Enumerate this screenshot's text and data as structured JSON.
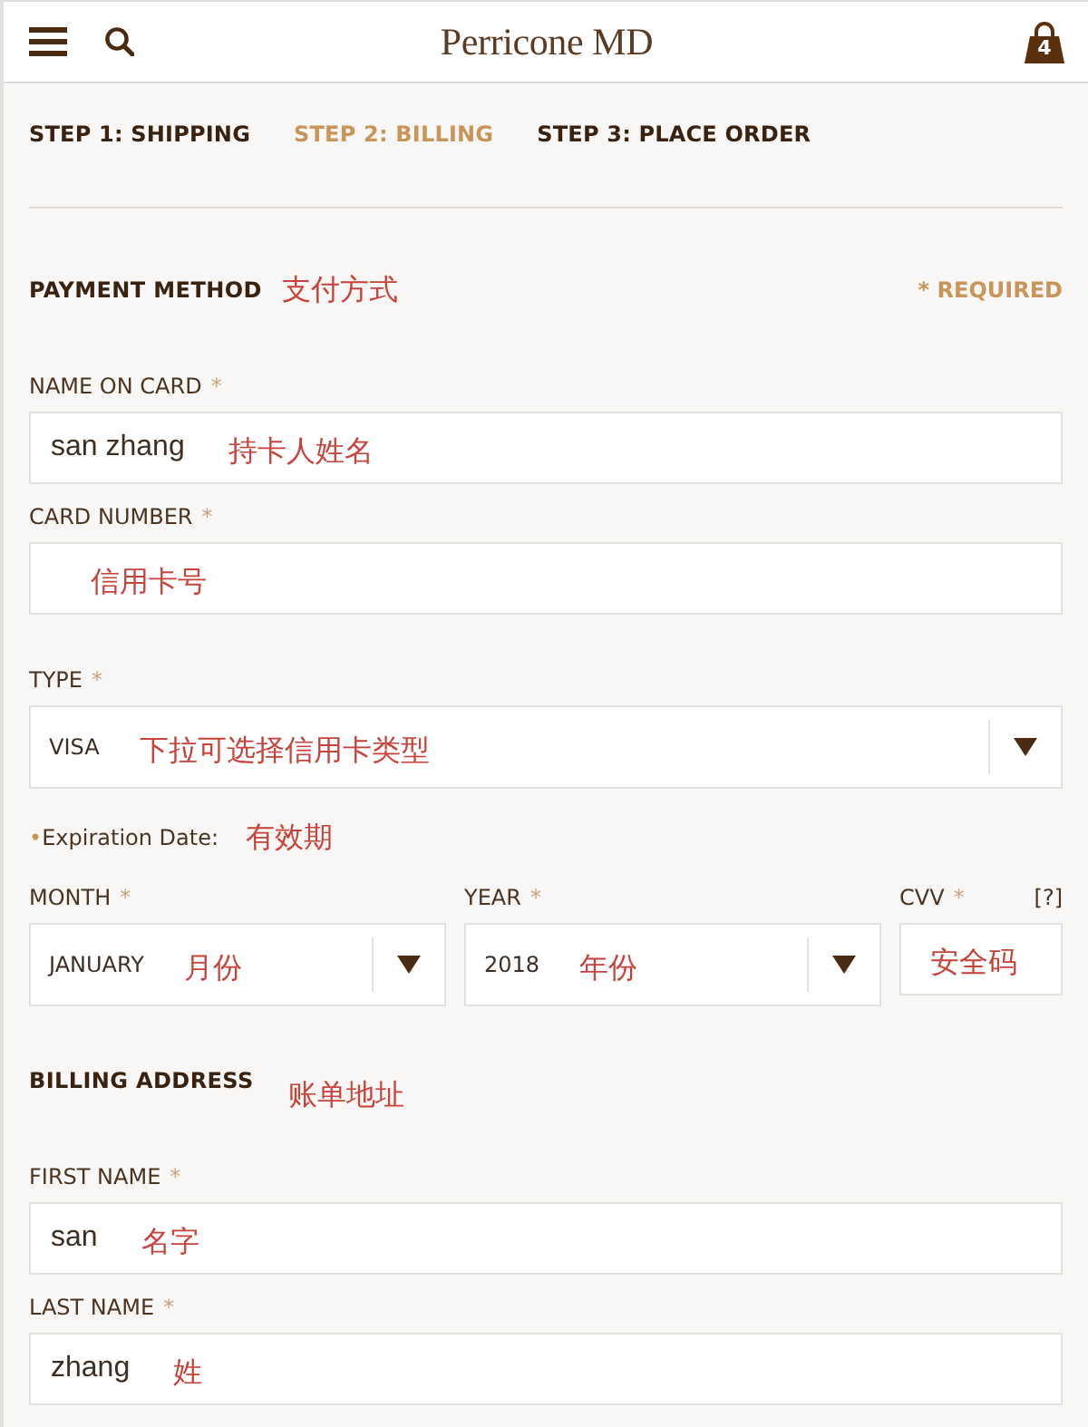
{
  "header": {
    "logo": "Perricone MD",
    "cart_count": "4"
  },
  "steps": [
    {
      "label": "STEP 1: SHIPPING",
      "selected": false
    },
    {
      "label": "STEP 2: BILLING",
      "selected": true
    },
    {
      "label": "STEP 3: PLACE ORDER",
      "selected": false
    }
  ],
  "payment_method": {
    "title": "PAYMENT METHOD",
    "annotation": "支付方式",
    "required_note": "* REQUIRED",
    "fields": [
      {
        "kind": "text",
        "label": "NAME ON CARD",
        "required_mark": "*",
        "value": "san zhang",
        "annotation": "持卡人姓名"
      },
      {
        "kind": "text",
        "label": "CARD NUMBER",
        "required_mark": "*",
        "annotation": "信用卡号"
      },
      {
        "kind": "select",
        "label": "TYPE",
        "required_mark": "*",
        "value": "VISA",
        "annotation": "下拉可选择信用卡类型"
      }
    ],
    "expiration": {
      "bullet": "•",
      "label": "Expiration Date:",
      "annotation": "有效期"
    },
    "expiration_fields": [
      {
        "kind": "select",
        "label": "MONTH",
        "required_mark": "*",
        "value": "JANUARY",
        "annotation": "月份"
      },
      {
        "kind": "select",
        "label": "YEAR",
        "required_mark": "*",
        "value": "2018",
        "annotation": "年份"
      },
      {
        "kind": "text",
        "label": "CVV",
        "required_mark": "*",
        "help": "[?]",
        "annotation": "安全码"
      }
    ]
  },
  "billing_address": {
    "title": "BILLING ADDRESS",
    "annotation": "账单地址",
    "fields": [
      {
        "kind": "text",
        "label": "FIRST NAME",
        "required_mark": "*",
        "value": "san",
        "annotation": "名字"
      },
      {
        "kind": "text",
        "label": "LAST NAME",
        "required_mark": "*",
        "value": "zhang",
        "annotation": "姓"
      }
    ]
  }
}
